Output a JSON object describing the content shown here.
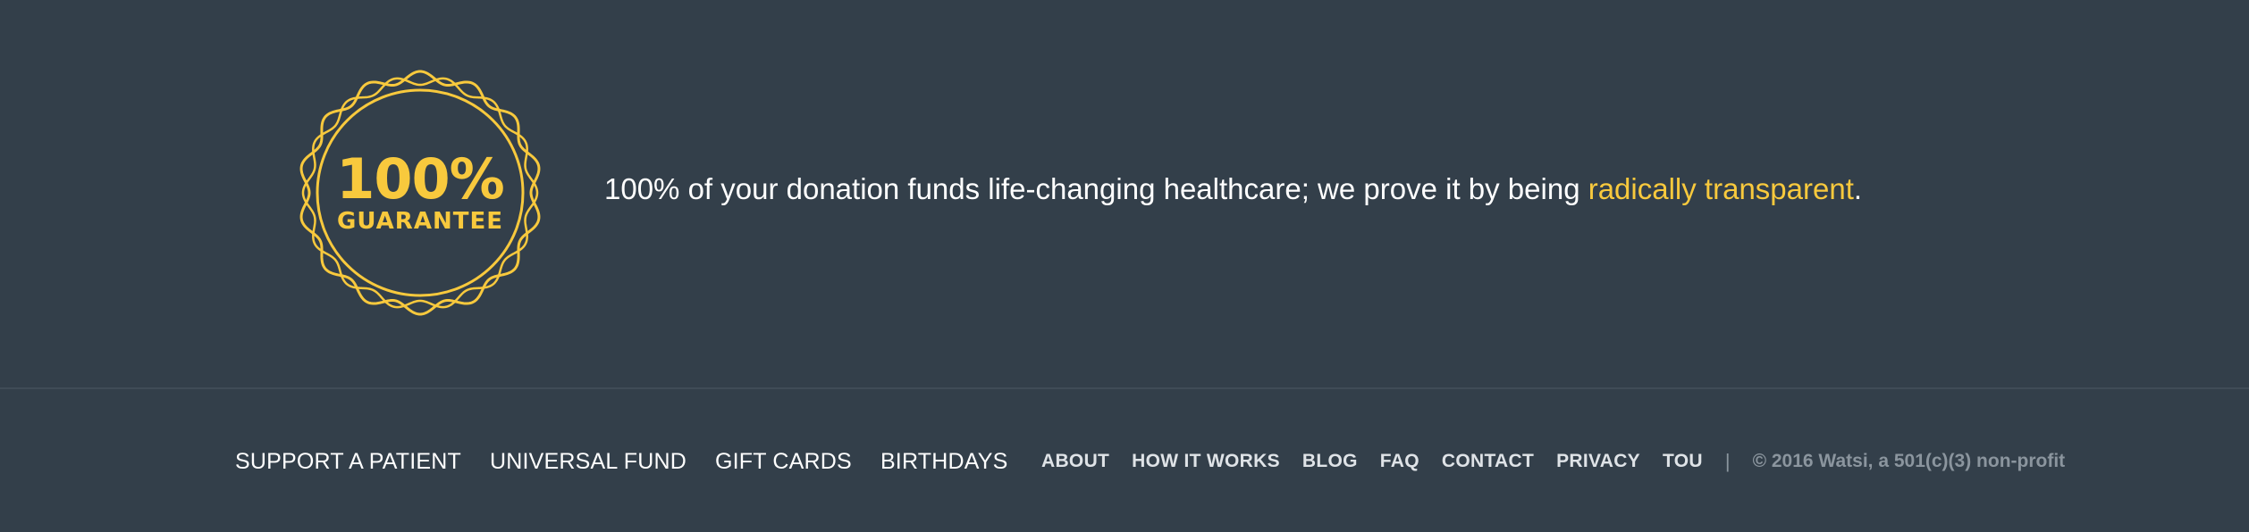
{
  "guarantee": {
    "badge_percent": "100%",
    "badge_word": "GUARANTEE",
    "message_prefix": "100% of your donation funds life-changing healthcare; we prove it by being ",
    "message_link": "radically transparent",
    "message_suffix": "."
  },
  "footer": {
    "primary_links": [
      {
        "label": "SUPPORT A PATIENT"
      },
      {
        "label": "UNIVERSAL FUND"
      },
      {
        "label": "GIFT CARDS"
      },
      {
        "label": "BIRTHDAYS"
      }
    ],
    "secondary_links": [
      {
        "label": "ABOUT"
      },
      {
        "label": "HOW IT WORKS"
      },
      {
        "label": "BLOG"
      },
      {
        "label": "FAQ"
      },
      {
        "label": "CONTACT"
      },
      {
        "label": "PRIVACY"
      },
      {
        "label": "TOU"
      }
    ],
    "separator": "|",
    "copyright": "© 2016 Watsi, a 501(c)(3) non-profit"
  },
  "colors": {
    "background": "#333f4a",
    "accent": "#f8c93d",
    "divider": "#404c57",
    "muted_text": "#8b959e"
  }
}
